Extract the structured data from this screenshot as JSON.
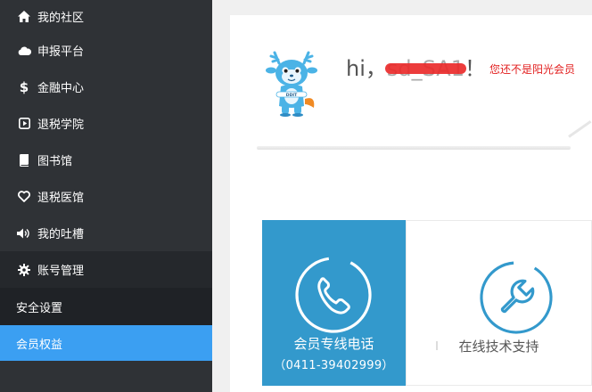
{
  "sidebar": {
    "items": [
      {
        "label": "我的社区",
        "icon": "home-icon"
      },
      {
        "label": "申报平台",
        "icon": "cloud-icon"
      },
      {
        "label": "金融中心",
        "icon": "dollar-icon"
      },
      {
        "label": "退税学院",
        "icon": "play-icon"
      },
      {
        "label": "图书馆",
        "icon": "book-icon"
      },
      {
        "label": "退税医馆",
        "icon": "heart-icon"
      },
      {
        "label": "我的吐槽",
        "icon": "volume-icon"
      }
    ],
    "account": {
      "label": "账号管理",
      "icon": "gear-icon"
    },
    "sub_items": [
      {
        "label": "安全设置",
        "active": false
      },
      {
        "label": "会员权益",
        "active": true
      }
    ]
  },
  "greeting": {
    "prefix": "hi，",
    "username": "sd_SA1",
    "suffix": "！",
    "notice": "您还不是阳光会员"
  },
  "services": [
    {
      "title": "会员专线电话",
      "phone": "（0411-39402999）",
      "icon": "phone-icon"
    },
    {
      "title": "在线技术支持",
      "icon": "wrench-icon"
    }
  ],
  "colors": {
    "sidebar_bg": "#2f3236",
    "active": "#3b9ff2",
    "tile_blue": "#3399cc",
    "notice_red": "#e21e1e"
  }
}
